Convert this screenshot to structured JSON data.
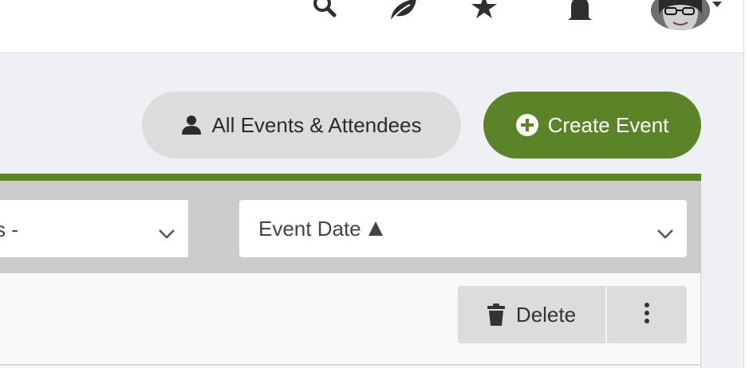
{
  "header": {
    "icons": [
      "search-icon",
      "leaf-icon",
      "star-icon",
      "bell-icon"
    ],
    "avatar_menu": "chevron-down-icon"
  },
  "actions": {
    "all_events_label": "All Events & Attendees",
    "create_event_label": "Create Event"
  },
  "filters": {
    "left_select_value": "s -",
    "sort_select_value": "Event Date"
  },
  "bulk_actions": {
    "delete_label": "Delete"
  },
  "colors": {
    "brand_green": "#5b8429",
    "pill_gray": "#dcdcdc",
    "filter_gray": "#cbcbcb"
  }
}
